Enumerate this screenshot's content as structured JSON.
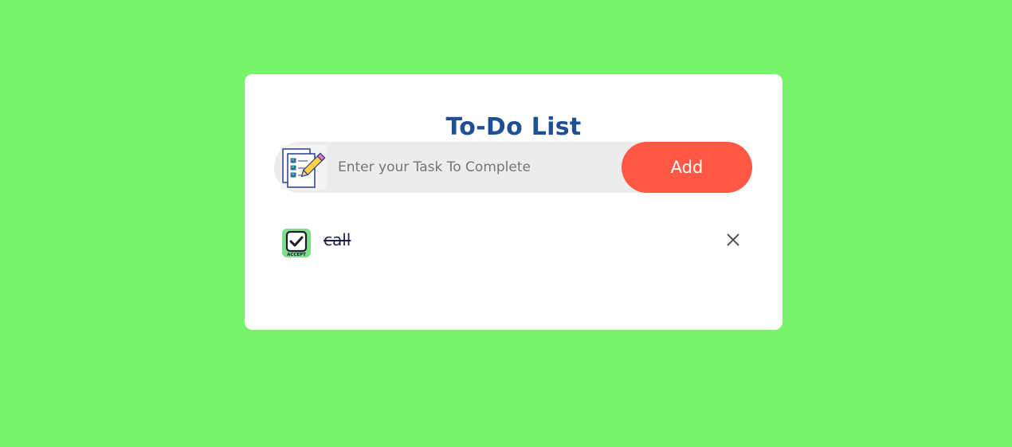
{
  "app": {
    "title": "To-Do List"
  },
  "input": {
    "placeholder": "Enter your Task To Complete",
    "value": "",
    "icon": "checklist-pencil-icon"
  },
  "add_button": {
    "label": "Add"
  },
  "tasks": [
    {
      "text": "call",
      "completed": true,
      "status_icon": "accept-check-icon",
      "status_icon_text": "ACCEPT",
      "remove_icon": "close-icon"
    }
  ],
  "colors": {
    "background": "#75f46b",
    "card": "#ffffff",
    "title": "#1f4f95",
    "add_button": "#ff5844",
    "input_bg": "#ececee"
  }
}
